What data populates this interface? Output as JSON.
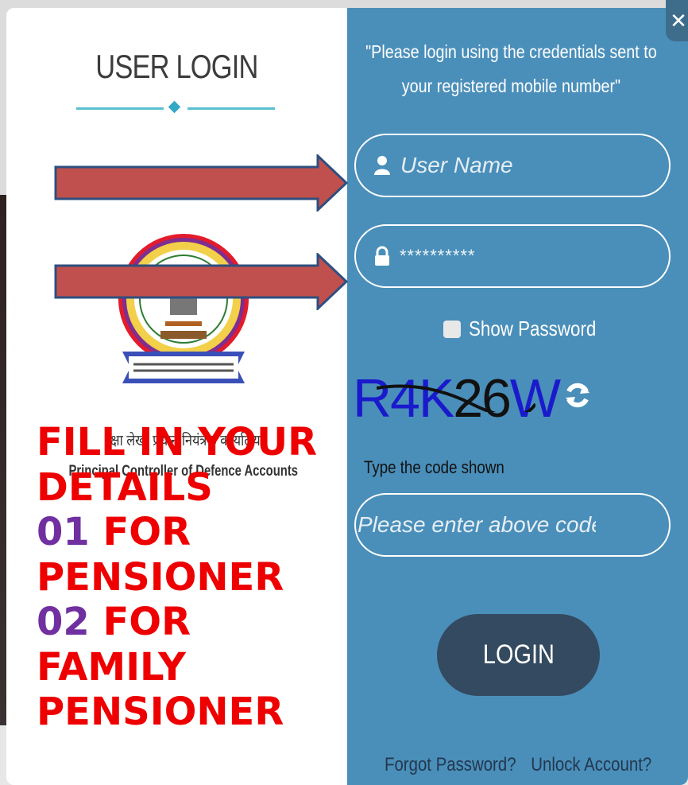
{
  "login": {
    "title": "USER LOGIN",
    "notice": "\"Please login using the credentials sent to your registered mobile number\"",
    "username_placeholder": "User Name",
    "password_mask": "**********",
    "show_password_label": "Show Password",
    "captcha": {
      "part1": "R4K",
      "part2": "26",
      "part3": "W"
    },
    "code_label": "Type the code shown",
    "code_placeholder": "Please enter above code",
    "login_button": "LOGIN",
    "forgot_password": "Forgot Password?",
    "unlock_account": "Unlock Account?"
  },
  "organization": {
    "hindi_name": "रक्षा लेखा प्रधान नियंत्रक कार्यालय",
    "english_name": "Principal Controller of Defence Accounts"
  },
  "overlay": {
    "line1": "FILL IN YOUR",
    "line2": "DETAILS",
    "num1": "01",
    "line3_rest": " FOR",
    "line4": "PENSIONER",
    "num2": "02",
    "line5_rest": " FOR",
    "line6": "FAMILY",
    "line7": "PENSIONER"
  },
  "colors": {
    "panel_blue": "#4a8fba",
    "button_dark": "#344a60",
    "overlay_red": "#ee0000",
    "overlay_purple": "#7030a0",
    "arrow_fill": "#c0504d",
    "arrow_border": "#2f4f7f"
  }
}
